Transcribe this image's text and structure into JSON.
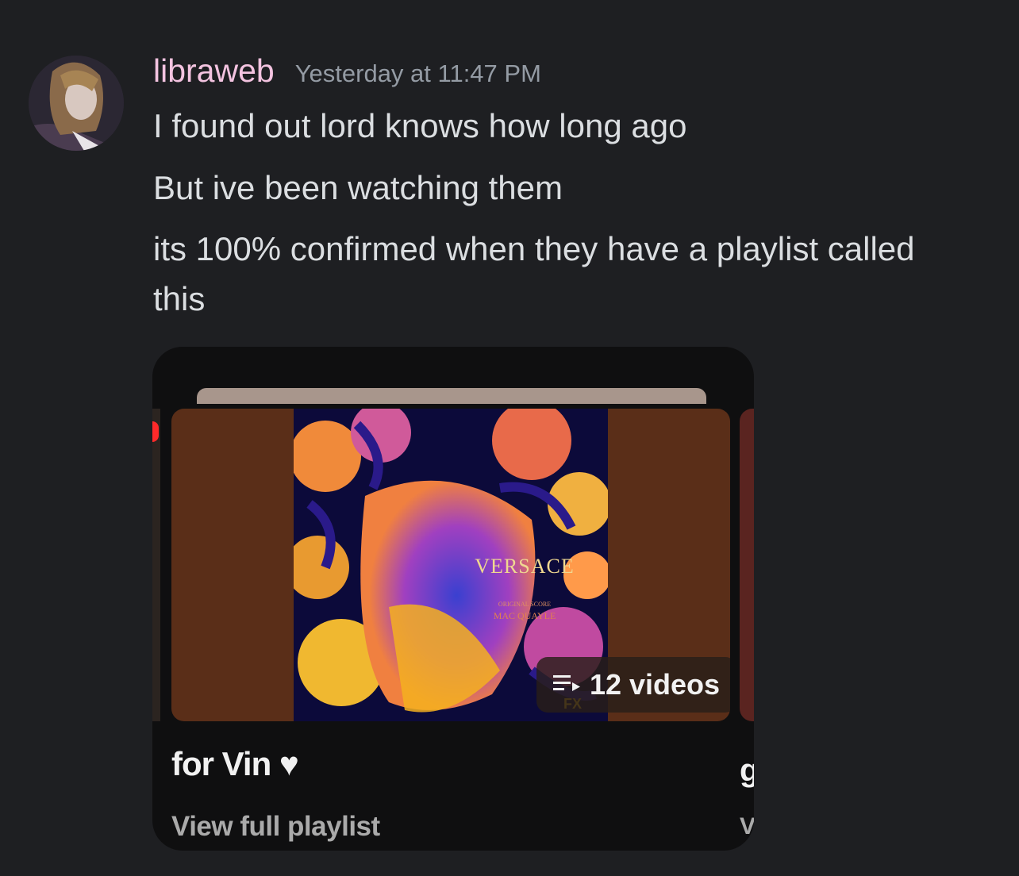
{
  "message": {
    "username": "libraweb",
    "timestamp": "Yesterday at 11:47 PM",
    "lines": [
      "I found out lord knows how long ago",
      "But ive been watching them",
      "its 100% confirmed when they have a playlist called",
      "this"
    ]
  },
  "embed": {
    "cover": {
      "title": "VERSACE",
      "subtitle": "ORIGINAL SCORE",
      "artist": "MAC QUAYLE",
      "network": "FX"
    },
    "badge_icon": "playlist-icon",
    "video_count": "12 videos",
    "playlist_title": "for Vin ♥",
    "view_link": "View full playlist",
    "peek_title": "g",
    "peek_link": "V"
  },
  "colors": {
    "background": "#1e1f22",
    "username": "#f3c3e0",
    "thumbnail_backdrop": "#5a2e18"
  }
}
